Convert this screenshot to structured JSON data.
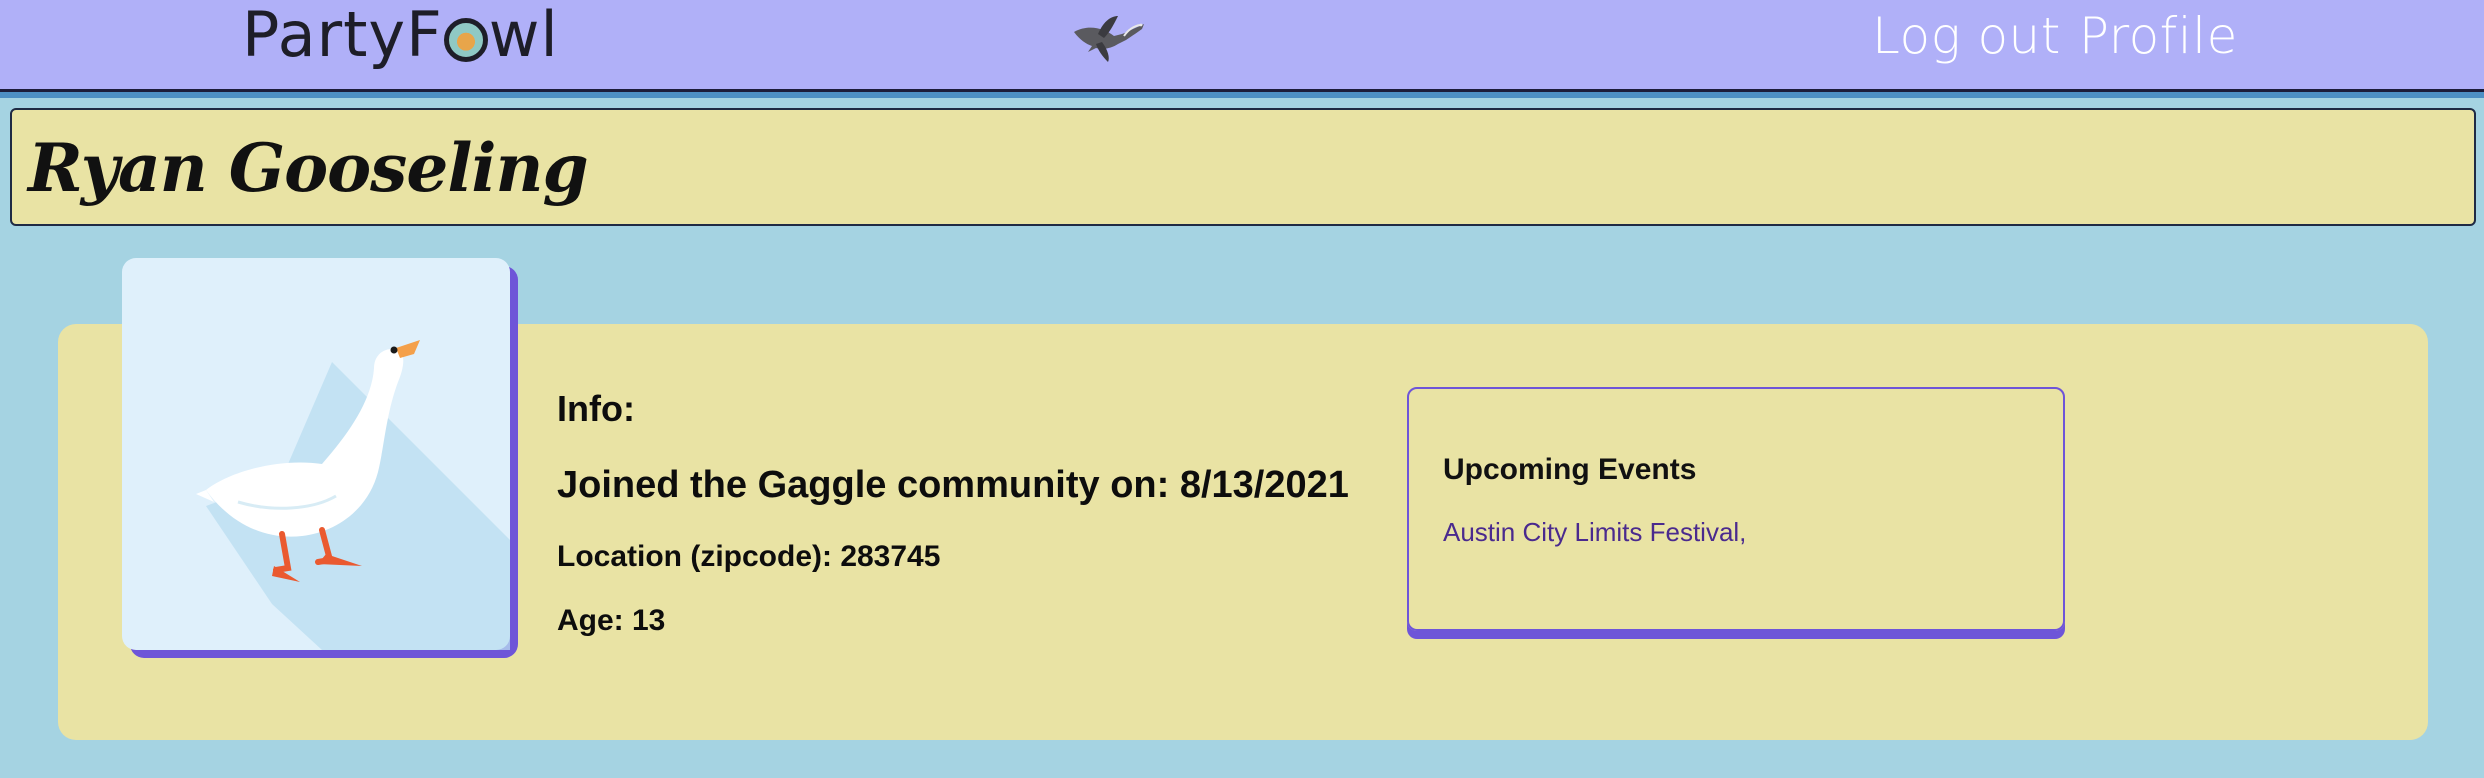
{
  "header": {
    "brand": {
      "prefix": "Party",
      "fowl_start": "F",
      "fowl_end": "wl"
    },
    "nav": [
      {
        "label": "Log out"
      },
      {
        "label": "Profile"
      }
    ],
    "logo_icon": "flying-goose-icon",
    "background_color": "#b0b0f8"
  },
  "profile": {
    "name": "Ryan Gooseling",
    "avatar_icon": "white-goose-icon",
    "info_title": "Info:",
    "joined": "Joined the Gaggle community on: 8/13/2021",
    "location": "Location (zipcode): 283745",
    "age": "Age: 13"
  },
  "events": {
    "title": "Upcoming Events",
    "items": [
      "Austin City Limits Festival,"
    ]
  },
  "colors": {
    "page_bg": "#a5d3e2",
    "card_bg": "#e9e3a4",
    "accent": "#6e55d8"
  }
}
